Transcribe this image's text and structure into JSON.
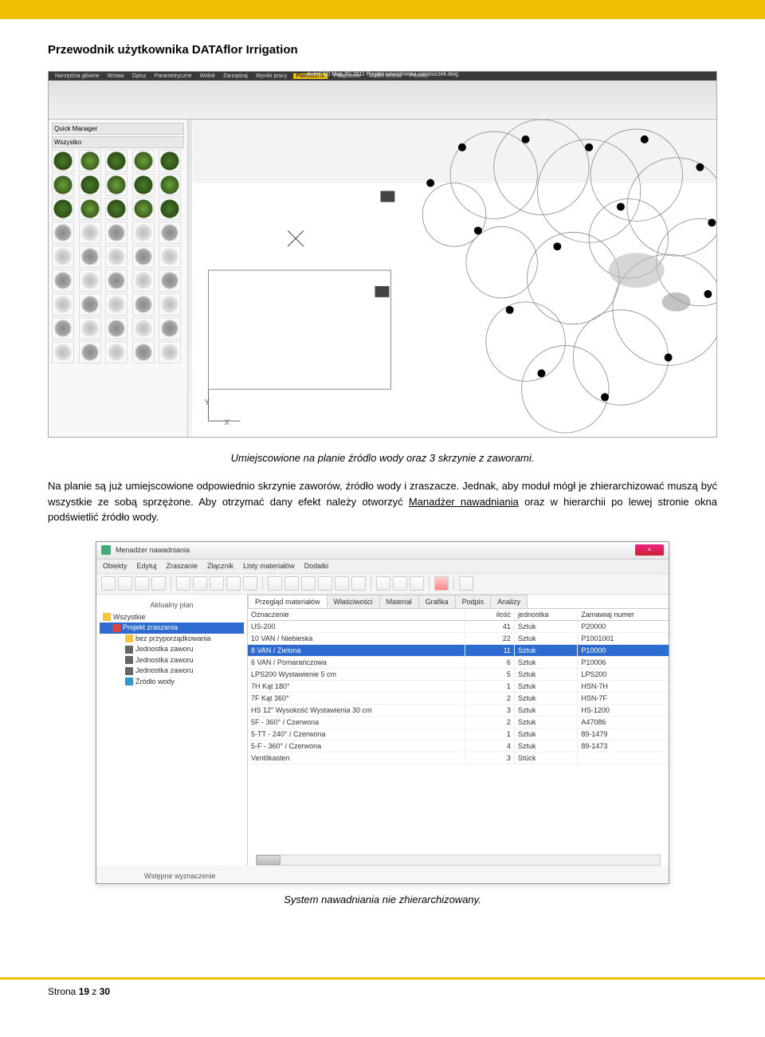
{
  "doc": {
    "title": "Przewodnik użytkownika DATAflor Irrigation",
    "caption1": "Umiejscowione na planie źródlo wody oraz 3 skrzynie z zaworami.",
    "paragraph_pre": "Na planie są już umiejscowione odpowiednio skrzynie zaworów, źródło wody i zraszacze. Jednak, aby moduł mógł je zhierarchizować muszą być wszystkie ze sobą sprzężone. Aby otrzymać dany efekt należy otworzyć ",
    "paragraph_link": "Manadżer nawadniania",
    "paragraph_post": " oraz w hierarchii po lewej stronie okna podświetlić źródło wody.",
    "caption2": "System nawadniania nie zhierarchizowany.",
    "footer_prefix": "Strona ",
    "footer_page": "19",
    "footer_mid": " z ",
    "footer_total": "30"
  },
  "shot1": {
    "app_title": "AutoCAD Map 3D 2011   Projekt nawodnienia samouczek.dwg",
    "tabs": [
      "Narzędzia główne",
      "Wstaw",
      "Opisz",
      "Parametryczne",
      "Widok",
      "Zarządzaj",
      "Wyniki pracy",
      "Planowanie",
      "Połączenie",
      "Model terenu",
      "Promoc"
    ],
    "active_tab": "Planowanie",
    "panel_title": "Quick Manager",
    "palette_filter": "Wszystko"
  },
  "mgr": {
    "title": "Menadżer nawadniania",
    "menus": [
      "Obiekty",
      "Edytuj",
      "Zraszanie",
      "Złącznik",
      "Listy materiałów",
      "Dodatki"
    ],
    "tree_label": "Aktualny plan",
    "tree": [
      {
        "label": "Wszystkie",
        "icon": "folder",
        "indent": 0
      },
      {
        "label": "Projekt zraszania",
        "icon": "folder-red",
        "indent": 1,
        "selected": true
      },
      {
        "label": "bez przyporządkowania",
        "icon": "folder",
        "indent": 2
      },
      {
        "label": "Jednostka zaworu",
        "icon": "valve",
        "indent": 2
      },
      {
        "label": "Jednostka zaworu",
        "icon": "valve",
        "indent": 2
      },
      {
        "label": "Jednostka zaworu",
        "icon": "valve",
        "indent": 2
      },
      {
        "label": "Źródło wody",
        "icon": "water",
        "indent": 2
      }
    ],
    "tabs": [
      "Przegląd materiałów",
      "Właściwości",
      "Materiał",
      "Grafika",
      "Podpis",
      "Analizy"
    ],
    "active_tab": "Przegląd materiałów",
    "columns": [
      "Oznaczenie",
      "ilość",
      "jednostka",
      "Zamawiaj numer"
    ],
    "rows": [
      {
        "c1": "US-200",
        "c2": "41",
        "c3": "Sztuk",
        "c4": "P20000"
      },
      {
        "c1": "10 VAN / Niebieska",
        "c2": "22",
        "c3": "Sztuk",
        "c4": "P1001001"
      },
      {
        "c1": "8 VAN / Zielona",
        "c2": "11",
        "c3": "Sztuk",
        "c4": "P10000",
        "selected": true
      },
      {
        "c1": "6 VAN / Pomarańczowa",
        "c2": "6",
        "c3": "Sztuk",
        "c4": "P10006"
      },
      {
        "c1": "LPS200 Wystawienie 5 cm",
        "c2": "5",
        "c3": "Sztuk",
        "c4": "LPS200"
      },
      {
        "c1": "7H Kąt 180°",
        "c2": "1",
        "c3": "Sztuk",
        "c4": "HSN-7H"
      },
      {
        "c1": "7F Kąt 360°",
        "c2": "2",
        "c3": "Sztuk",
        "c4": "HSN-7F"
      },
      {
        "c1": "HS 12\" Wysokość Wystawienia 30 cm",
        "c2": "3",
        "c3": "Sztuk",
        "c4": "HS-1200"
      },
      {
        "c1": "5F - 360° / Czerwona",
        "c2": "2",
        "c3": "Sztuk",
        "c4": "A47086"
      },
      {
        "c1": "5-TT - 240° / Czerwona",
        "c2": "1",
        "c3": "Sztuk",
        "c4": "89-1479"
      },
      {
        "c1": "5-F - 360° / Czerwona",
        "c2": "4",
        "c3": "Sztuk",
        "c4": "89-1473"
      },
      {
        "c1": "Ventilkasten",
        "c2": "3",
        "c3": "Stück",
        "c4": ""
      }
    ],
    "bottom_label": "Wstępne wyznaczenie"
  }
}
